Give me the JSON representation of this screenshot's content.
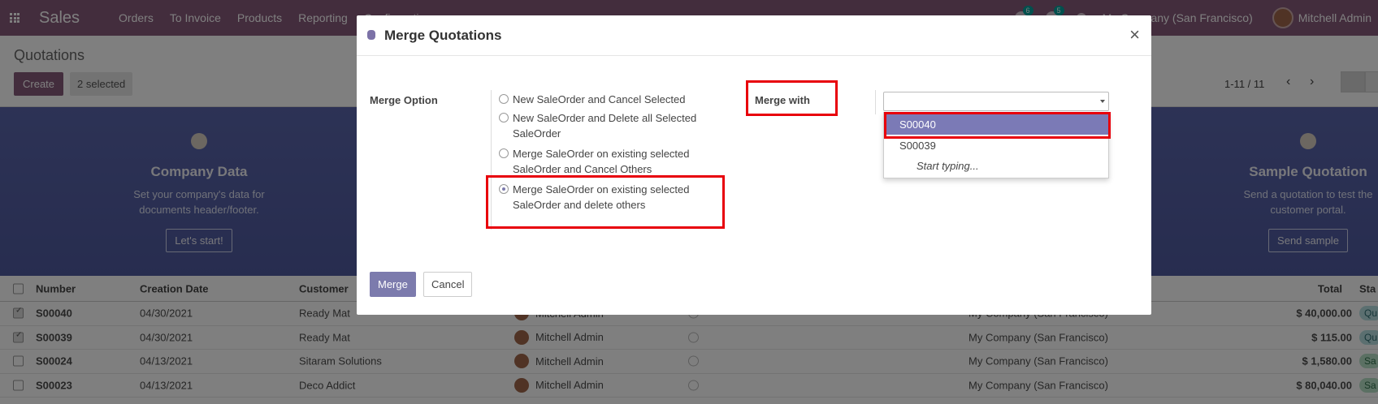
{
  "navbar": {
    "app_name": "Sales",
    "menu": [
      "Orders",
      "To Invoice",
      "Products",
      "Reporting",
      "Configuration"
    ],
    "chat_badge": "6",
    "activity_badge": "5",
    "company": "My Company (San Francisco)",
    "user": "Mitchell Admin"
  },
  "control": {
    "breadcrumb": "Quotations",
    "create_label": "Create",
    "selected_label": "2 selected",
    "pager": "1-11 / 11"
  },
  "banner": {
    "steps": [
      {
        "title": "Company Data",
        "desc1": "Set your company's data for",
        "desc2": "documents header/footer.",
        "button": "Let's start!"
      },
      {
        "title": "Sample Quotation",
        "desc1": "Send a quotation to test the",
        "desc2": "customer portal.",
        "button": "Send sample"
      }
    ]
  },
  "table": {
    "headers": {
      "number": "Number",
      "date": "Creation Date",
      "customer": "Customer",
      "total": "Total",
      "status": "Sta"
    },
    "rows": [
      {
        "number": "S00040",
        "date": "04/30/2021",
        "customer": "Ready Mat",
        "salesperson": "Mitchell Admin",
        "company": "My Company (San Francisco)",
        "total": "$ 40,000.00",
        "status": "Qu",
        "checked": true
      },
      {
        "number": "S00039",
        "date": "04/30/2021",
        "customer": "Ready Mat",
        "salesperson": "Mitchell Admin",
        "company": "My Company (San Francisco)",
        "total": "$ 115.00",
        "status": "Qu",
        "checked": true
      },
      {
        "number": "S00024",
        "date": "04/13/2021",
        "customer": "Sitaram Solutions",
        "salesperson": "Mitchell Admin",
        "company": "My Company (San Francisco)",
        "total": "$ 1,580.00",
        "status": "Sa",
        "checked": false
      },
      {
        "number": "S00023",
        "date": "04/13/2021",
        "customer": "Deco Addict",
        "salesperson": "Mitchell Admin",
        "company": "My Company (San Francisco)",
        "total": "$ 80,040.00",
        "status": "Sa",
        "checked": false
      }
    ]
  },
  "modal": {
    "title": "Merge Quotations",
    "merge_option_label": "Merge Option",
    "options": [
      {
        "line1": "New SaleOrder and Cancel Selected",
        "line2": "",
        "selected": false
      },
      {
        "line1": "New SaleOrder and Delete all Selected",
        "line2": "SaleOrder",
        "selected": false
      },
      {
        "line1": "Merge SaleOrder on existing selected",
        "line2": "SaleOrder and Cancel Others",
        "selected": false
      },
      {
        "line1": "Merge SaleOrder on existing selected",
        "line2": "SaleOrder and delete others",
        "selected": true
      }
    ],
    "merge_with_label": "Merge with",
    "merge_with_value": "",
    "dropdown": [
      "S00040",
      "S00039"
    ],
    "dropdown_hint": "Start typing...",
    "merge_button": "Merge",
    "cancel_button": "Cancel"
  },
  "colors": {
    "brand": "#875a7b",
    "highlight": "#e8000b",
    "dropdown_active": "#7b7ab6"
  }
}
